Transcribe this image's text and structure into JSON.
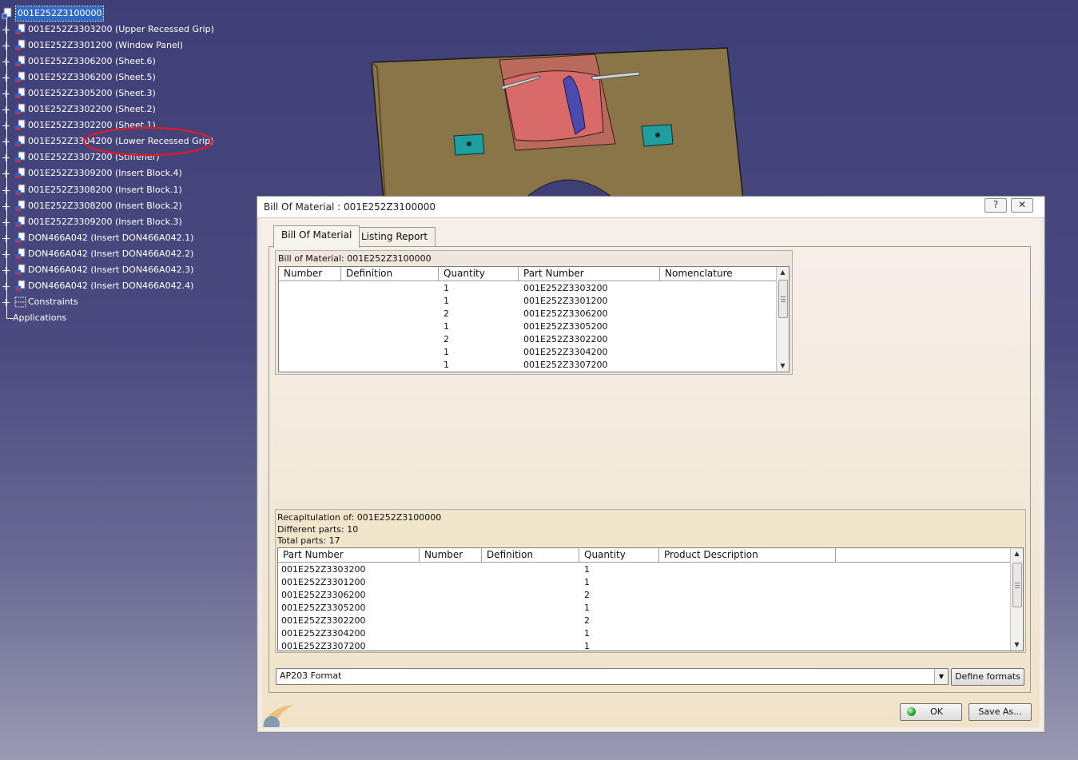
{
  "tree": {
    "root": "001E252Z3100000",
    "items": [
      {
        "label": "001E252Z3303200 (Upper Recessed Grip)",
        "icon": "part-icon"
      },
      {
        "label": "001E252Z3301200 (Window Panel)",
        "icon": "part-icon"
      },
      {
        "label": "001E252Z3306200 (Sheet.6)",
        "icon": "part-icon"
      },
      {
        "label": "001E252Z3306200 (Sheet.5)",
        "icon": "part-icon"
      },
      {
        "label": "001E252Z3305200 (Sheet.3)",
        "icon": "part-icon"
      },
      {
        "label": "001E252Z3302200 (Sheet.2)",
        "icon": "part-icon"
      },
      {
        "label": "001E252Z3302200 (Sheet.1)",
        "icon": "part-icon"
      },
      {
        "label": "001E252Z3304200 (Lower Recessed Grip)",
        "icon": "part-icon"
      },
      {
        "label": "001E252Z3307200 (Stiffener)",
        "icon": "part-icon"
      },
      {
        "label": "001E252Z3309200 (Insert Block.4)",
        "icon": "part-icon"
      },
      {
        "label": "001E252Z3308200 (Insert Block.1)",
        "icon": "part-icon"
      },
      {
        "label": "001E252Z3308200 (Insert Block.2)",
        "icon": "part-icon"
      },
      {
        "label": "001E252Z3309200 (Insert Block.3)",
        "icon": "part-icon"
      },
      {
        "label": "DON466A042 (Insert DON466A042.1)",
        "icon": "part-icon"
      },
      {
        "label": "DON466A042 (Insert DON466A042.2)",
        "icon": "part-icon"
      },
      {
        "label": "DON466A042 (Insert DON466A042.3)",
        "icon": "part-icon"
      },
      {
        "label": "DON466A042 (Insert DON466A042.4)",
        "icon": "part-icon"
      },
      {
        "label": "Constraints",
        "icon": "constraints-icon"
      }
    ],
    "applications": "Applications"
  },
  "dialog": {
    "title": "Bill Of Material : 001E252Z3100000",
    "help_label": "?",
    "close_label": "✕",
    "tabs": [
      "Bill Of Material",
      "Listing Report"
    ],
    "bom": {
      "caption": "Bill of Material: 001E252Z3100000",
      "columns": [
        "Number",
        "Definition",
        "Quantity",
        "Part Number",
        "Nomenclature"
      ],
      "rows": [
        {
          "quantity": "1",
          "part_number": "001E252Z3303200"
        },
        {
          "quantity": "1",
          "part_number": "001E252Z3301200"
        },
        {
          "quantity": "2",
          "part_number": "001E252Z3306200"
        },
        {
          "quantity": "1",
          "part_number": "001E252Z3305200"
        },
        {
          "quantity": "2",
          "part_number": "001E252Z3302200"
        },
        {
          "quantity": "1",
          "part_number": "001E252Z3304200"
        },
        {
          "quantity": "1",
          "part_number": "001E252Z3307200"
        }
      ]
    },
    "recap": {
      "title": "Recapitulation of: 001E252Z3100000",
      "different_parts": "Different parts: 10",
      "total_parts": "Total parts: 17",
      "columns": [
        "Part Number",
        "Number",
        "Definition",
        "Quantity",
        "Product Description"
      ],
      "rows": [
        {
          "part_number": "001E252Z3303200",
          "quantity": "1"
        },
        {
          "part_number": "001E252Z3301200",
          "quantity": "1"
        },
        {
          "part_number": "001E252Z3306200",
          "quantity": "2"
        },
        {
          "part_number": "001E252Z3305200",
          "quantity": "1"
        },
        {
          "part_number": "001E252Z3302200",
          "quantity": "2"
        },
        {
          "part_number": "001E252Z3304200",
          "quantity": "1"
        },
        {
          "part_number": "001E252Z3307200",
          "quantity": "1"
        }
      ]
    },
    "format_value": "AP203 Format",
    "define_formats_label": "Define formats",
    "ok_label": "OK",
    "save_as_label": "Save As..."
  },
  "colors": {
    "background_top": "#3f3f78",
    "selection": "#316ac5",
    "annotation_circle": "#d0202a",
    "plate": "#8a7548",
    "grip": "#d86a6a",
    "insert_block": "#1e9e9e"
  }
}
